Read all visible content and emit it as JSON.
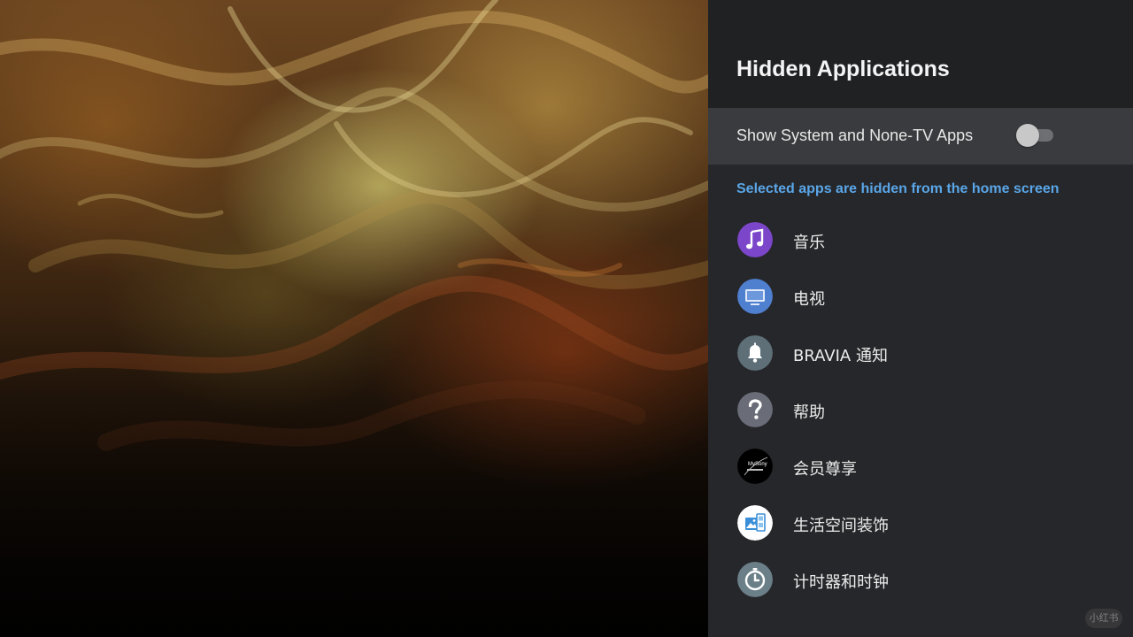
{
  "panel": {
    "title": "Hidden Applications",
    "toggle": {
      "label": "Show System and None-TV Apps",
      "enabled": false
    },
    "hint": "Selected apps are hidden from the home screen",
    "apps": [
      {
        "label": "音乐",
        "icon": "music-note-icon",
        "color": "#7b46c9"
      },
      {
        "label": "电视",
        "icon": "tv-icon",
        "color": "#4f7fcf"
      },
      {
        "label": "BRAVIA 通知",
        "icon": "bell-icon",
        "color": "#5e6f78"
      },
      {
        "label": "帮助",
        "icon": "question-mark-icon",
        "color": "#6a6d78"
      },
      {
        "label": "会员尊享",
        "icon": "mysony-icon",
        "color": "#000000",
        "icon_text": "MySony"
      },
      {
        "label": "生活空间装饰",
        "icon": "living-decor-icon",
        "color": "#ffffff"
      },
      {
        "label": "计时器和时钟",
        "icon": "timer-clock-icon",
        "color": "#6b7f89"
      }
    ]
  },
  "watermark": "小红书",
  "colors": {
    "panel_bg": "#26272a",
    "header_bg": "#202123",
    "selected_row": "#3a3b3e",
    "accent": "#5aa6e8"
  }
}
